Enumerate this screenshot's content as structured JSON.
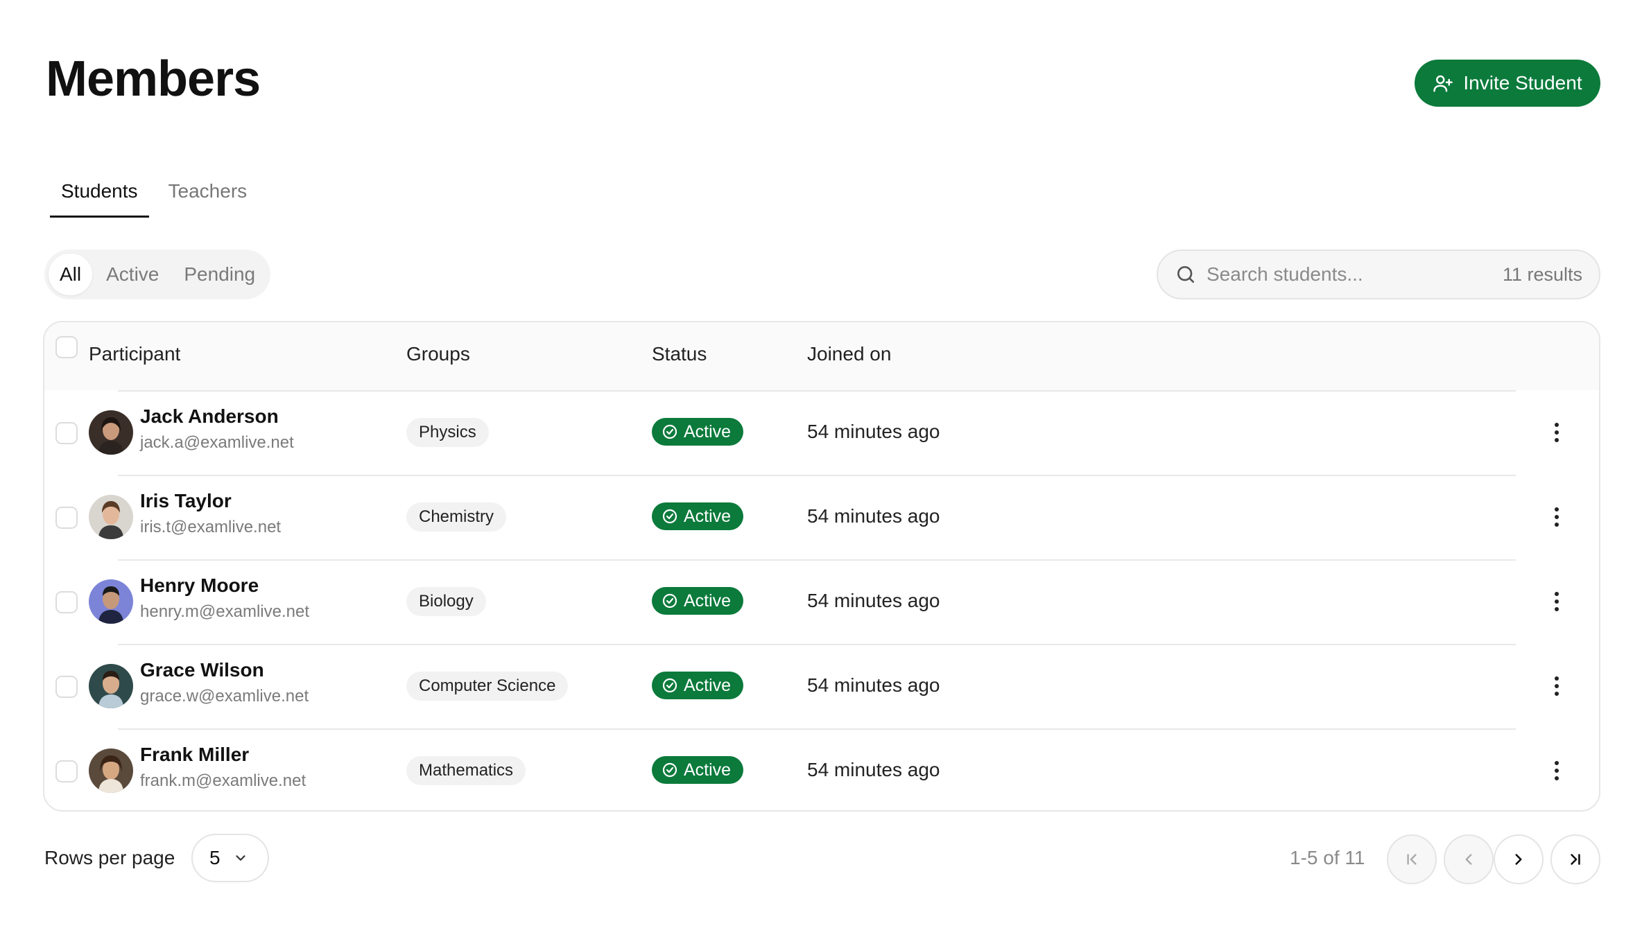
{
  "header": {
    "title": "Members",
    "invite_label": "Invite Student",
    "invite_icon": "user-plus-icon"
  },
  "tabs": [
    {
      "label": "Students",
      "active": true
    },
    {
      "label": "Teachers",
      "active": false
    }
  ],
  "filters": [
    {
      "label": "All",
      "active": true
    },
    {
      "label": "Active",
      "active": false
    },
    {
      "label": "Pending",
      "active": false
    }
  ],
  "search": {
    "placeholder": "Search students...",
    "value": "",
    "results_label": "11 results"
  },
  "table": {
    "columns": {
      "participant": "Participant",
      "groups": "Groups",
      "status": "Status",
      "joined": "Joined on"
    },
    "rows": [
      {
        "name": "Jack Anderson",
        "email": "jack.a@examlive.net",
        "group": "Physics",
        "status": "Active",
        "joined": "54 minutes ago"
      },
      {
        "name": "Iris Taylor",
        "email": "iris.t@examlive.net",
        "group": "Chemistry",
        "status": "Active",
        "joined": "54 minutes ago"
      },
      {
        "name": "Henry Moore",
        "email": "henry.m@examlive.net",
        "group": "Biology",
        "status": "Active",
        "joined": "54 minutes ago"
      },
      {
        "name": "Grace Wilson",
        "email": "grace.w@examlive.net",
        "group": "Computer Science",
        "status": "Active",
        "joined": "54 minutes ago"
      },
      {
        "name": "Frank Miller",
        "email": "frank.m@examlive.net",
        "group": "Mathematics",
        "status": "Active",
        "joined": "54 minutes ago"
      }
    ]
  },
  "pagination": {
    "rows_per_page_label": "Rows per page",
    "rows_per_page_value": "5",
    "range_label": "1-5 of 11"
  },
  "colors": {
    "accent_green": "#0b7a3b",
    "border": "#e6e6e6"
  }
}
